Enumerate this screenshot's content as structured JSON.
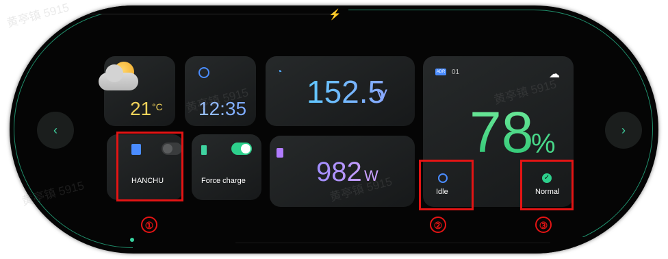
{
  "weather": {
    "temperature": "21",
    "unit": "°C",
    "icon": "partly-cloudy-icon"
  },
  "clock": {
    "time": "12:35"
  },
  "voltage": {
    "value": "152.5",
    "unit": "V"
  },
  "power": {
    "value": "982",
    "unit": "W"
  },
  "hanchu": {
    "label": "HANCHU",
    "toggle_on": false
  },
  "force_charge": {
    "label": "Force charge",
    "toggle_on": true
  },
  "battery": {
    "address": "01",
    "soc": "78",
    "soc_unit": "%",
    "state": "Idle",
    "status": "Normal"
  },
  "annotations": [
    "①",
    "②",
    "③"
  ],
  "watermark": "黄亭镇 5915",
  "colors": {
    "accent_green": "#38d39f",
    "highlight_red": "#e41414",
    "blue": "#4a8cff"
  }
}
